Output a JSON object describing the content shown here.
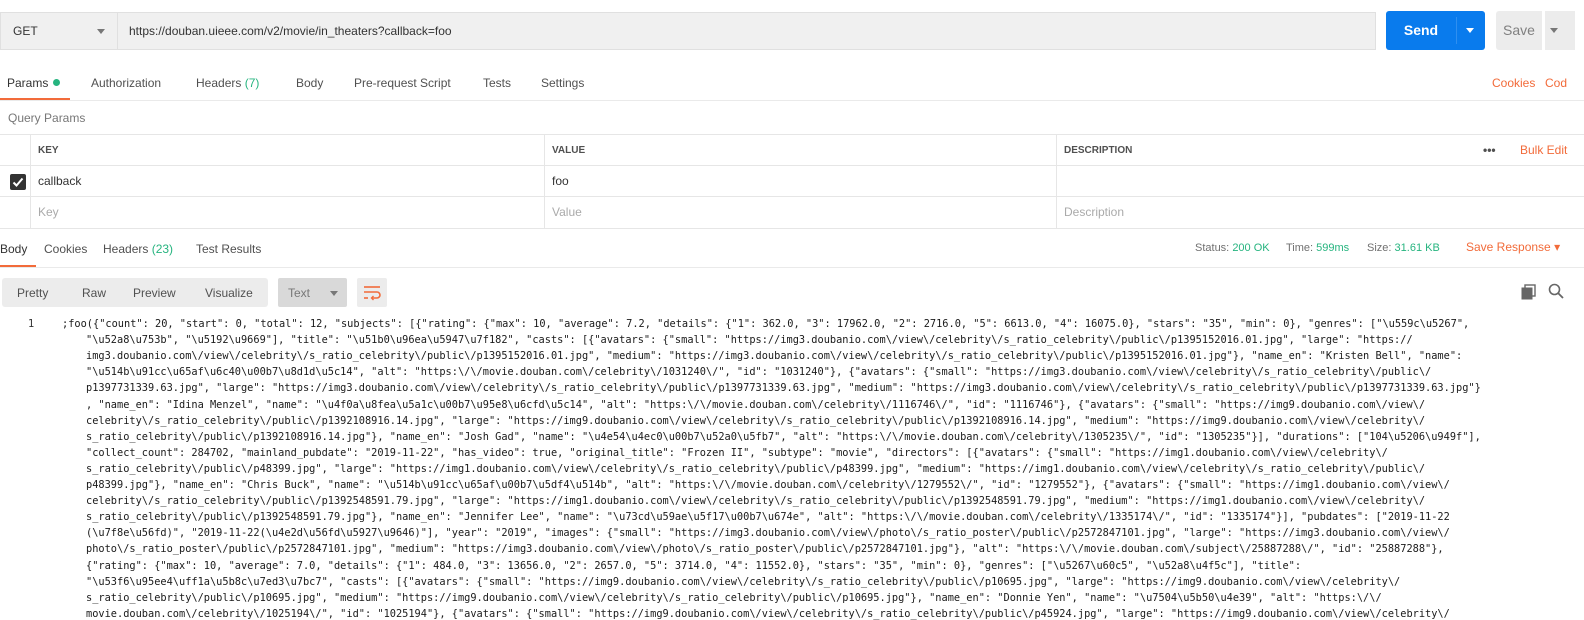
{
  "request": {
    "method": "GET",
    "url": "https://douban.uieee.com/v2/movie/in_theaters?callback=foo",
    "send_label": "Send",
    "save_label": "Save"
  },
  "request_tabs": [
    {
      "label": "Params",
      "active": true
    },
    {
      "label": "Authorization"
    },
    {
      "label": "Headers",
      "count": "(7)"
    },
    {
      "label": "Body"
    },
    {
      "label": "Pre-request Script"
    },
    {
      "label": "Tests"
    },
    {
      "label": "Settings"
    }
  ],
  "request_right_links": {
    "cookies": "Cookies",
    "code": "Cod"
  },
  "query_params": {
    "title": "Query Params",
    "columns": {
      "key": "KEY",
      "value": "VALUE",
      "description": "DESCRIPTION"
    },
    "more": "•••",
    "bulk_edit": "Bulk Edit",
    "rows": [
      {
        "checked": true,
        "key": "callback",
        "value": "foo",
        "description": ""
      }
    ],
    "placeholders": {
      "key": "Key",
      "value": "Value",
      "description": "Description"
    }
  },
  "response_tabs": [
    {
      "label": "Body",
      "active": true
    },
    {
      "label": "Cookies"
    },
    {
      "label": "Headers",
      "count": "(23)"
    },
    {
      "label": "Test Results"
    }
  ],
  "response_meta": {
    "status_label": "Status:",
    "status": "200 OK",
    "time_label": "Time:",
    "time": "599ms",
    "size_label": "Size:",
    "size": "31.61 KB",
    "save_response": "Save Response"
  },
  "view_modes": [
    "Pretty",
    "Raw",
    "Preview",
    "Visualize"
  ],
  "format": "Text",
  "code": {
    "line_number": "1",
    "lines": [
      ";foo({\"count\": 20, \"start\": 0, \"total\": 12, \"subjects\": [{\"rating\": {\"max\": 10, \"average\": 7.2, \"details\": {\"1\": 362.0, \"3\": 17962.0, \"2\": 2716.0, \"5\": 6613.0, \"4\": 16075.0}, \"stars\": \"35\", \"min\": 0}, \"genres\": [\"\\u559c\\u5267\",",
      "\"\\u52a8\\u753b\", \"\\u5192\\u9669\"], \"title\": \"\\u51b0\\u96ea\\u5947\\u7f182\", \"casts\": [{\"avatars\": {\"small\": \"https://img3.doubanio.com\\/view\\/celebrity\\/s_ratio_celebrity\\/public\\/p1395152016.01.jpg\", \"large\": \"https://",
      "img3.doubanio.com\\/view\\/celebrity\\/s_ratio_celebrity\\/public\\/p1395152016.01.jpg\", \"medium\": \"https://img3.doubanio.com\\/view\\/celebrity\\/s_ratio_celebrity\\/public\\/p1395152016.01.jpg\"}, \"name_en\": \"Kristen Bell\", \"name\":",
      "\"\\u514b\\u91cc\\u65af\\u6c40\\u00b7\\u8d1d\\u5c14\", \"alt\": \"https:\\/\\/movie.douban.com\\/celebrity\\/1031240\\/\", \"id\": \"1031240\"}, {\"avatars\": {\"small\": \"https://img3.doubanio.com\\/view\\/celebrity\\/s_ratio_celebrity\\/public\\/",
      "p1397731339.63.jpg\", \"large\": \"https://img3.doubanio.com\\/view\\/celebrity\\/s_ratio_celebrity\\/public\\/p1397731339.63.jpg\", \"medium\": \"https://img3.doubanio.com\\/view\\/celebrity\\/s_ratio_celebrity\\/public\\/p1397731339.63.jpg\"}",
      ", \"name_en\": \"Idina Menzel\", \"name\": \"\\u4f0a\\u8fea\\u5a1c\\u00b7\\u95e8\\u6cfd\\u5c14\", \"alt\": \"https:\\/\\/movie.douban.com\\/celebrity\\/1116746\\/\", \"id\": \"1116746\"}, {\"avatars\": {\"small\": \"https://img9.doubanio.com\\/view\\/",
      "celebrity\\/s_ratio_celebrity\\/public\\/p1392108916.14.jpg\", \"large\": \"https://img9.doubanio.com\\/view\\/celebrity\\/s_ratio_celebrity\\/public\\/p1392108916.14.jpg\", \"medium\": \"https://img9.doubanio.com\\/view\\/celebrity\\/",
      "s_ratio_celebrity\\/public\\/p1392108916.14.jpg\"}, \"name_en\": \"Josh Gad\", \"name\": \"\\u4e54\\u4ec0\\u00b7\\u52a0\\u5fb7\", \"alt\": \"https:\\/\\/movie.douban.com\\/celebrity\\/1305235\\/\", \"id\": \"1305235\"}], \"durations\": [\"104\\u5206\\u949f\"],",
      "\"collect_count\": 284702, \"mainland_pubdate\": \"2019-11-22\", \"has_video\": true, \"original_title\": \"Frozen II\", \"subtype\": \"movie\", \"directors\": [{\"avatars\": {\"small\": \"https://img1.doubanio.com\\/view\\/celebrity\\/",
      "s_ratio_celebrity\\/public\\/p48399.jpg\", \"large\": \"https://img1.doubanio.com\\/view\\/celebrity\\/s_ratio_celebrity\\/public\\/p48399.jpg\", \"medium\": \"https://img1.doubanio.com\\/view\\/celebrity\\/s_ratio_celebrity\\/public\\/",
      "p48399.jpg\"}, \"name_en\": \"Chris Buck\", \"name\": \"\\u514b\\u91cc\\u65af\\u00b7\\u5df4\\u514b\", \"alt\": \"https:\\/\\/movie.douban.com\\/celebrity\\/1279552\\/\", \"id\": \"1279552\"}, {\"avatars\": {\"small\": \"https://img1.doubanio.com\\/view\\/",
      "celebrity\\/s_ratio_celebrity\\/public\\/p1392548591.79.jpg\", \"large\": \"https://img1.doubanio.com\\/view\\/celebrity\\/s_ratio_celebrity\\/public\\/p1392548591.79.jpg\", \"medium\": \"https://img1.doubanio.com\\/view\\/celebrity\\/",
      "s_ratio_celebrity\\/public\\/p1392548591.79.jpg\"}, \"name_en\": \"Jennifer Lee\", \"name\": \"\\u73cd\\u59ae\\u5f17\\u00b7\\u674e\", \"alt\": \"https:\\/\\/movie.douban.com\\/celebrity\\/1335174\\/\", \"id\": \"1335174\"}], \"pubdates\": [\"2019-11-22",
      "(\\u7f8e\\u56fd)\", \"2019-11-22(\\u4e2d\\u56fd\\u5927\\u9646)\"], \"year\": \"2019\", \"images\": {\"small\": \"https://img3.doubanio.com\\/view\\/photo\\/s_ratio_poster\\/public\\/p2572847101.jpg\", \"large\": \"https://img3.doubanio.com\\/view\\/",
      "photo\\/s_ratio_poster\\/public\\/p2572847101.jpg\", \"medium\": \"https://img3.doubanio.com\\/view\\/photo\\/s_ratio_poster\\/public\\/p2572847101.jpg\"}, \"alt\": \"https:\\/\\/movie.douban.com\\/subject\\/25887288\\/\", \"id\": \"25887288\"},",
      "{\"rating\": {\"max\": 10, \"average\": 7.0, \"details\": {\"1\": 484.0, \"3\": 13656.0, \"2\": 2657.0, \"5\": 3714.0, \"4\": 11552.0}, \"stars\": \"35\", \"min\": 0}, \"genres\": [\"\\u5267\\u60c5\", \"\\u52a8\\u4f5c\"], \"title\":",
      "\"\\u53f6\\u95ee4\\uff1a\\u5b8c\\u7ed3\\u7bc7\", \"casts\": [{\"avatars\": {\"small\": \"https://img9.doubanio.com\\/view\\/celebrity\\/s_ratio_celebrity\\/public\\/p10695.jpg\", \"large\": \"https://img9.doubanio.com\\/view\\/celebrity\\/",
      "s_ratio_celebrity\\/public\\/p10695.jpg\", \"medium\": \"https://img9.doubanio.com\\/view\\/celebrity\\/s_ratio_celebrity\\/public\\/p10695.jpg\"}, \"name_en\": \"Donnie Yen\", \"name\": \"\\u7504\\u5b50\\u4e39\", \"alt\": \"https:\\/\\/",
      "movie.douban.com\\/celebrity\\/1025194\\/\", \"id\": \"1025194\"}, {\"avatars\": {\"small\": \"https://img9.doubanio.com\\/view\\/celebrity\\/s_ratio_celebrity\\/public\\/p45924.jpg\", \"large\": \"https://img9.doubanio.com\\/view\\/celebrity\\/"
    ]
  }
}
